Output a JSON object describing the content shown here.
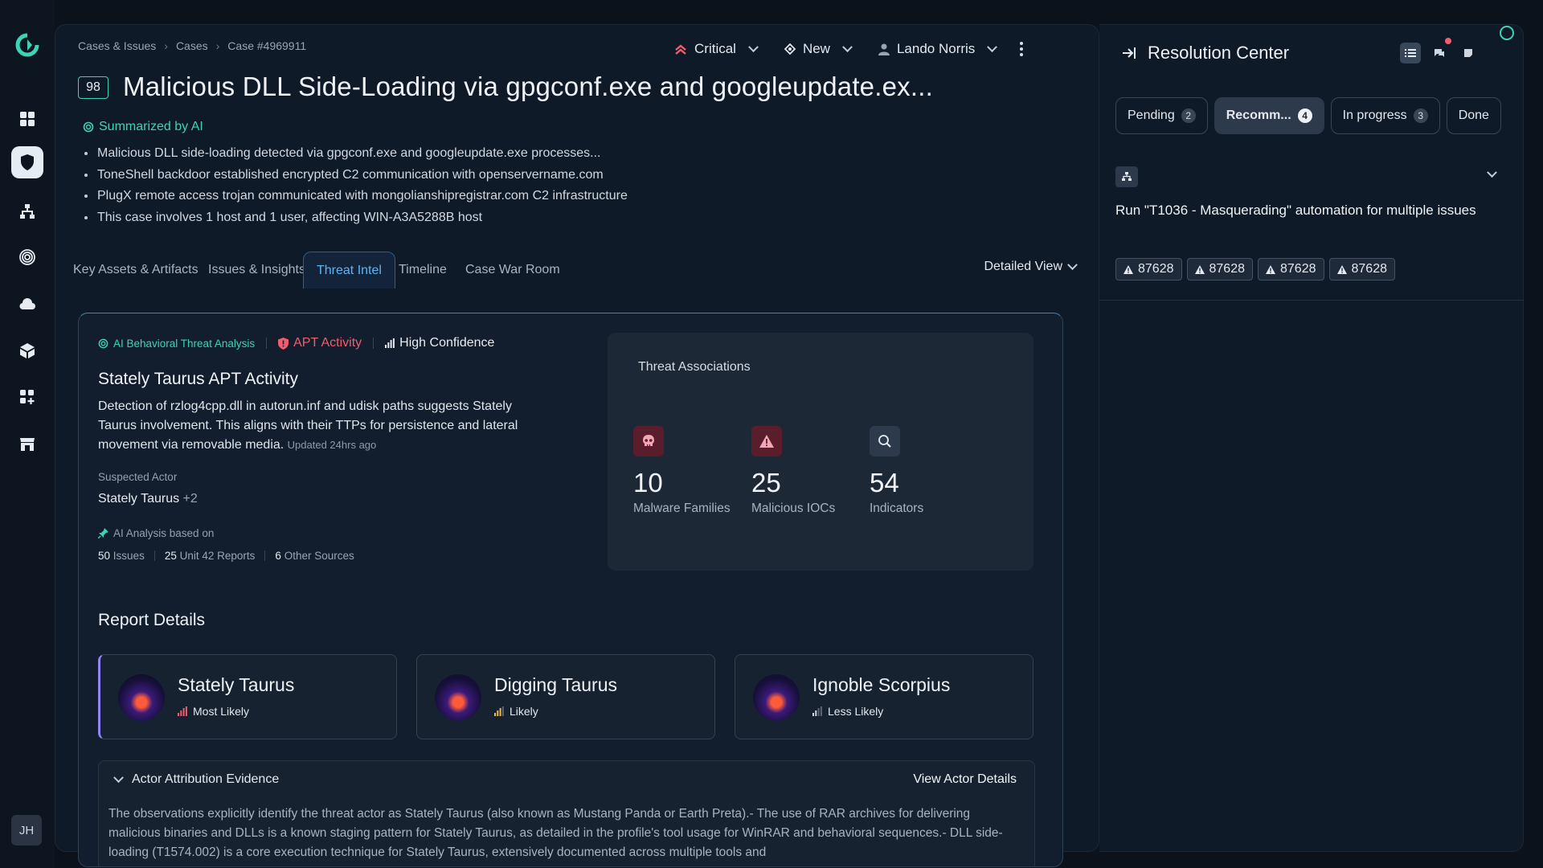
{
  "rail": {
    "avatar": "JH",
    "items": [
      "dashboard-icon",
      "shield-icon",
      "network-icon",
      "fingerprint-icon",
      "cloud-icon",
      "cube-icon",
      "apps-add-icon",
      "storefront-icon"
    ],
    "accent": "#3ed3b5"
  },
  "breadcrumb": [
    "Cases & Issues",
    "Cases",
    "Case #4969911"
  ],
  "header": {
    "severity": "Critical",
    "status": "New",
    "assignee": "Lando Norris",
    "score": "98",
    "title": "Malicious DLL Side-Loading via gpgconf.exe and googleupdate.ex..."
  },
  "summary": {
    "label": "Summarized by AI",
    "bullets": [
      "Malicious DLL side-loading detected via gpgconf.exe and googleupdate.exe processes...",
      "ToneShell backdoor established encrypted C2 communication with openservername.com",
      "PlugX remote access trojan communicated with mongolianshipregistrar.com C2 infrastructure",
      "This case involves 1 host and 1 user, affecting WIN-A3A5288B host"
    ]
  },
  "tabs": [
    "Key Assets & Artifacts",
    "Issues & Insights",
    "Threat Intel",
    "Timeline",
    "Case War Room"
  ],
  "active_tab": "Threat Intel",
  "view_select": "Detailed View",
  "intel": {
    "ai_label": "AI Behavioral Threat Analysis",
    "apt_label": "APT Activity",
    "confidence": "High Confidence",
    "title": "Stately Taurus APT Activity",
    "description": "Detection of rzlog4cpp.dll in autorun.inf and udisk paths suggests Stately Taurus involvement. This aligns with their TTPs for persistence and lateral movement via removable media.",
    "updated": "Updated 24hrs ago",
    "suspected_label": "Suspected Actor",
    "suspected_value": "Stately Taurus",
    "suspected_more": "+2",
    "basis_label": "AI Analysis based on",
    "basis": [
      {
        "num": "50",
        "label": "Issues"
      },
      {
        "num": "25",
        "label": "Unit 42 Reports"
      },
      {
        "num": "6",
        "label": "Other Sources"
      }
    ]
  },
  "associations": {
    "title": "Threat Associations",
    "stats": [
      {
        "value": "10",
        "label": "Malware Families",
        "icon": "skull-icon"
      },
      {
        "value": "25",
        "label": "Malicious IOCs",
        "icon": "warning-icon"
      },
      {
        "value": "54",
        "label": "Indicators",
        "icon": "search-icon"
      }
    ]
  },
  "report": {
    "title": "Report Details",
    "actors": [
      {
        "name": "Stately Taurus",
        "likelihood": "Most Likely",
        "color": "#f25c6c"
      },
      {
        "name": "Digging Taurus",
        "likelihood": "Likely",
        "color": "#f2b84b"
      },
      {
        "name": "Ignoble Scorpius",
        "likelihood": "Less Likely",
        "color": "#cfd6e0"
      }
    ],
    "evidence_title": "Actor Attribution Evidence",
    "evidence_link": "View Actor Details",
    "evidence_text": "The observations explicitly identify the threat actor as Stately Taurus (also known as Mustang Panda or Earth Preta).- The use of RAR archives for delivering malicious binaries and DLLs is a known staging pattern for Stately Taurus, as detailed in the profile's tool usage for WinRAR and behavioral sequences.- DLL side-loading (T1574.002) is a core execution technique for Stately Taurus, extensively documented across multiple tools and"
  },
  "resolution": {
    "title": "Resolution Center",
    "tabs": [
      {
        "label": "Pending",
        "count": "2"
      },
      {
        "label": "Recomm...",
        "count": "4"
      },
      {
        "label": "In progress",
        "count": "3"
      },
      {
        "label": "Done",
        "count": ""
      }
    ],
    "recommendation": "Run \"T1036 - Masquerading\" automation for multiple issues",
    "chips": [
      "87628",
      "87628",
      "87628",
      "87628"
    ]
  }
}
